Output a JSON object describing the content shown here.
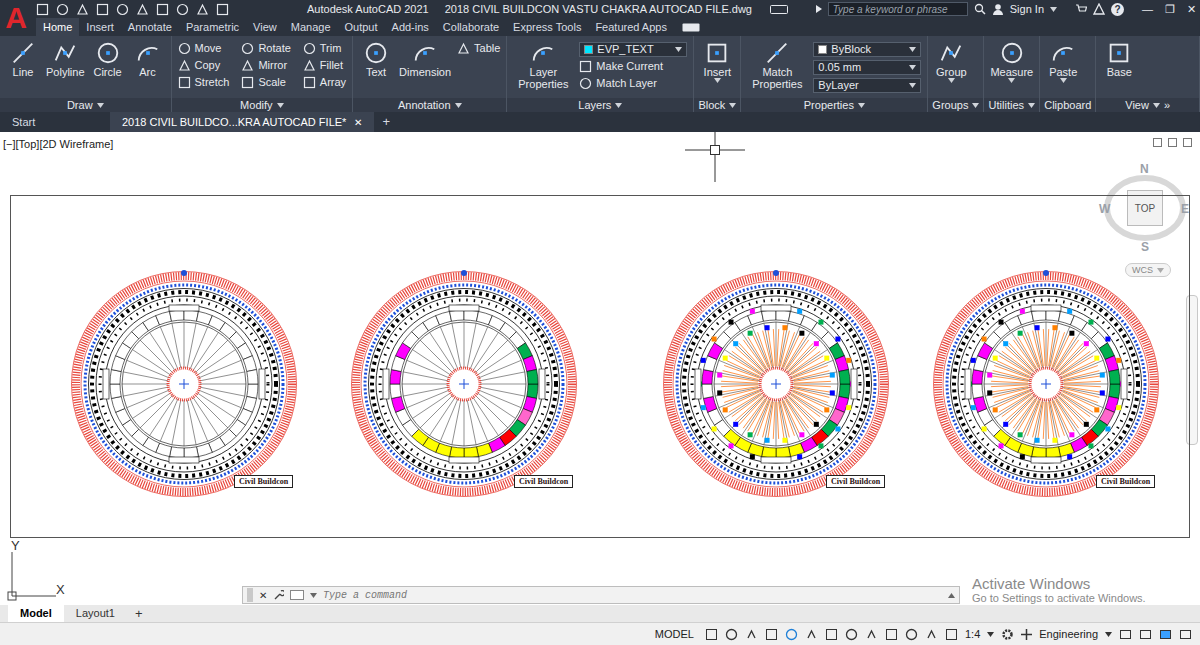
{
  "app": {
    "logo": "A",
    "name": "Autodesk AutoCAD 2021",
    "file": "2018 CIVIL BUILDCON VASTU CHAKRA AUTOCAD FILE.dwg"
  },
  "search": {
    "placeholder": "Type a keyword or phrase"
  },
  "account": {
    "label": "Sign In"
  },
  "help": "?",
  "window_controls": [
    "—",
    "❐",
    "✕"
  ],
  "ribbon_tabs": [
    {
      "label": "Home",
      "selected": true
    },
    {
      "label": "Insert",
      "selected": false
    },
    {
      "label": "Annotate",
      "selected": false
    },
    {
      "label": "Parametric",
      "selected": false
    },
    {
      "label": "View",
      "selected": false
    },
    {
      "label": "Manage",
      "selected": false
    },
    {
      "label": "Output",
      "selected": false
    },
    {
      "label": "Add-ins",
      "selected": false
    },
    {
      "label": "Collaborate",
      "selected": false
    },
    {
      "label": "Express Tools",
      "selected": false
    },
    {
      "label": "Featured Apps",
      "selected": false
    }
  ],
  "ribbon_panels": [
    {
      "title": "Draw",
      "menu": true,
      "large": [
        "Line",
        "Polyline",
        "Circle",
        "Arc"
      ],
      "small": [],
      "fields": []
    },
    {
      "title": "Modify",
      "menu": true,
      "large": [],
      "small": [
        "Move",
        "Copy",
        "Stretch",
        "Rotate",
        "Mirror",
        "Scale",
        "Trim",
        "Fillet",
        "Array"
      ],
      "fields": []
    },
    {
      "title": "Annotation",
      "menu": true,
      "large": [
        "Text",
        "Dimension"
      ],
      "small": [
        "Table"
      ],
      "fields": []
    },
    {
      "title": "Layers",
      "menu": true,
      "large": [
        "Layer Properties"
      ],
      "small": [
        "Make Current",
        "Match Layer"
      ],
      "fields": [
        {
          "text": "EVP_TEXT",
          "color": "#00e5ff"
        }
      ]
    },
    {
      "title": "Block",
      "menu": true,
      "large": [
        "Insert"
      ],
      "small": [],
      "fields": []
    },
    {
      "title": "Properties",
      "menu": true,
      "large": [
        "Match Properties"
      ],
      "small": [],
      "fields": [
        {
          "text": "ByBlock",
          "color": "#ffffff"
        },
        {
          "text": "0.05 mm"
        },
        {
          "text": "ByLayer"
        }
      ]
    },
    {
      "title": "Groups",
      "menu": true,
      "large": [
        "Group"
      ],
      "small": [],
      "fields": []
    },
    {
      "title": "Utilities",
      "menu": true,
      "large": [
        "Measure"
      ],
      "small": [],
      "fields": []
    },
    {
      "title": "Clipboard",
      "menu": false,
      "large": [
        "Paste"
      ],
      "small": [],
      "fields": []
    },
    {
      "title": "View",
      "menu": true,
      "extra": "»",
      "large": [
        "Base"
      ],
      "small": [],
      "fields": []
    }
  ],
  "file_tabs": [
    {
      "label": "Start",
      "selected": false,
      "closable": false
    },
    {
      "label": "2018 CIVIL BUILDCO...KRA AUTOCAD FILE*",
      "selected": true,
      "closable": true
    }
  ],
  "file_tab_close": "✕",
  "new_tab": "+",
  "viewport_label": "[−][Top][2D Wireframe]",
  "viewcube": {
    "north": "N",
    "south": "S",
    "east": "E",
    "west": "W",
    "face": "TOP",
    "ucs": "WCS"
  },
  "chakras": [
    {
      "kind": "plain",
      "logo": "Civil Buildcon"
    },
    {
      "kind": "ring",
      "logo": "Civil Buildcon"
    },
    {
      "kind": "full",
      "logo": "Civil Buildcon"
    },
    {
      "kind": "full",
      "logo": "Civil Buildcon"
    }
  ],
  "ucs_axes": {
    "x": "X",
    "y": "Y"
  },
  "command_line": {
    "close": "✕",
    "placeholder": "Type a command"
  },
  "watermark": {
    "title": "Activate Windows",
    "subtitle": "Go to Settings to activate Windows."
  },
  "layout_tabs": [
    {
      "label": "Model",
      "selected": true
    },
    {
      "label": "Layout1",
      "selected": false
    }
  ],
  "add_layout": "+",
  "status_bar": {
    "space": "MODEL",
    "scale": "1:4",
    "units": "Engineering"
  }
}
